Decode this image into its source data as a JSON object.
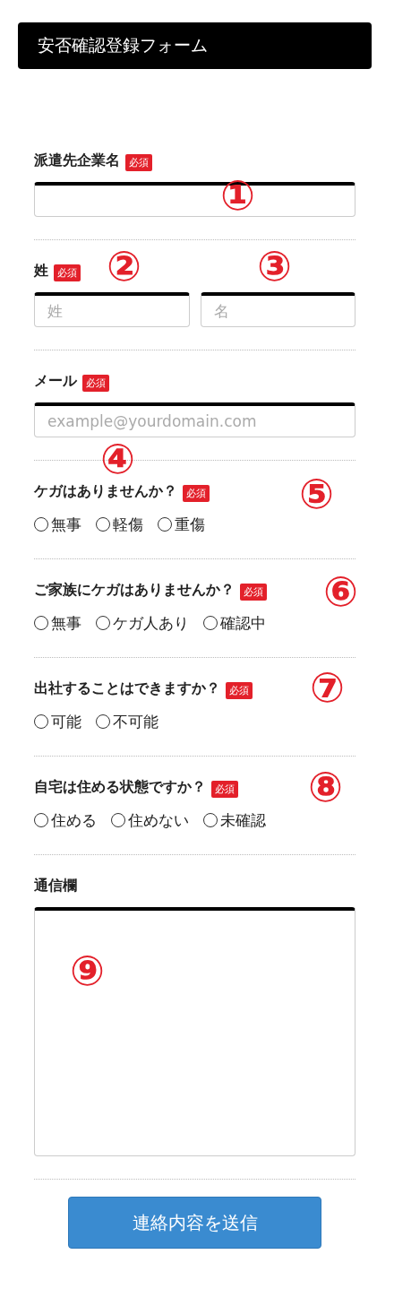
{
  "header": {
    "title": "安否確認登録フォーム"
  },
  "sections": [
    {
      "kind": "text",
      "label": "派遣先企業名",
      "required": "必須",
      "markers": [
        "①"
      ]
    },
    {
      "kind": "name",
      "label": "姓",
      "required": "必須",
      "markers": [
        "②",
        "③"
      ],
      "fields": [
        {
          "placeholder": "姓"
        },
        {
          "placeholder": "名"
        }
      ]
    },
    {
      "kind": "text",
      "label": "メール",
      "required": "必須",
      "markers": [
        "④"
      ],
      "placeholder": "example@yourdomain.com"
    },
    {
      "kind": "radio",
      "label": "ケガはありませんか？",
      "required": "必須",
      "markers": [
        "⑤"
      ],
      "options": [
        {
          "label": "無事",
          "selected": false
        },
        {
          "label": "軽傷",
          "selected": false
        },
        {
          "label": "重傷",
          "selected": false
        }
      ]
    },
    {
      "kind": "radio",
      "label": "ご家族にケガはありませんか？",
      "required": "必須",
      "markers": [
        "⑥"
      ],
      "options": [
        {
          "label": "無事",
          "selected": false
        },
        {
          "label": "ケガ人あり",
          "selected": false
        },
        {
          "label": "確認中",
          "selected": false
        }
      ]
    },
    {
      "kind": "radio",
      "label": "出社することはできますか？",
      "required": "必須",
      "markers": [
        "⑦"
      ],
      "options": [
        {
          "label": "可能",
          "selected": false
        },
        {
          "label": "不可能",
          "selected": false
        }
      ]
    },
    {
      "kind": "radio",
      "label": "自宅は住める状態ですか？",
      "required": "必須",
      "markers": [
        "⑧"
      ],
      "options": [
        {
          "label": "住める",
          "selected": false
        },
        {
          "label": "住めない",
          "selected": false
        },
        {
          "label": "未確認",
          "selected": false
        }
      ]
    },
    {
      "kind": "textarea",
      "label": "通信欄",
      "markers": [
        "⑨"
      ]
    }
  ],
  "submit": {
    "label": "連絡内容を送信"
  }
}
